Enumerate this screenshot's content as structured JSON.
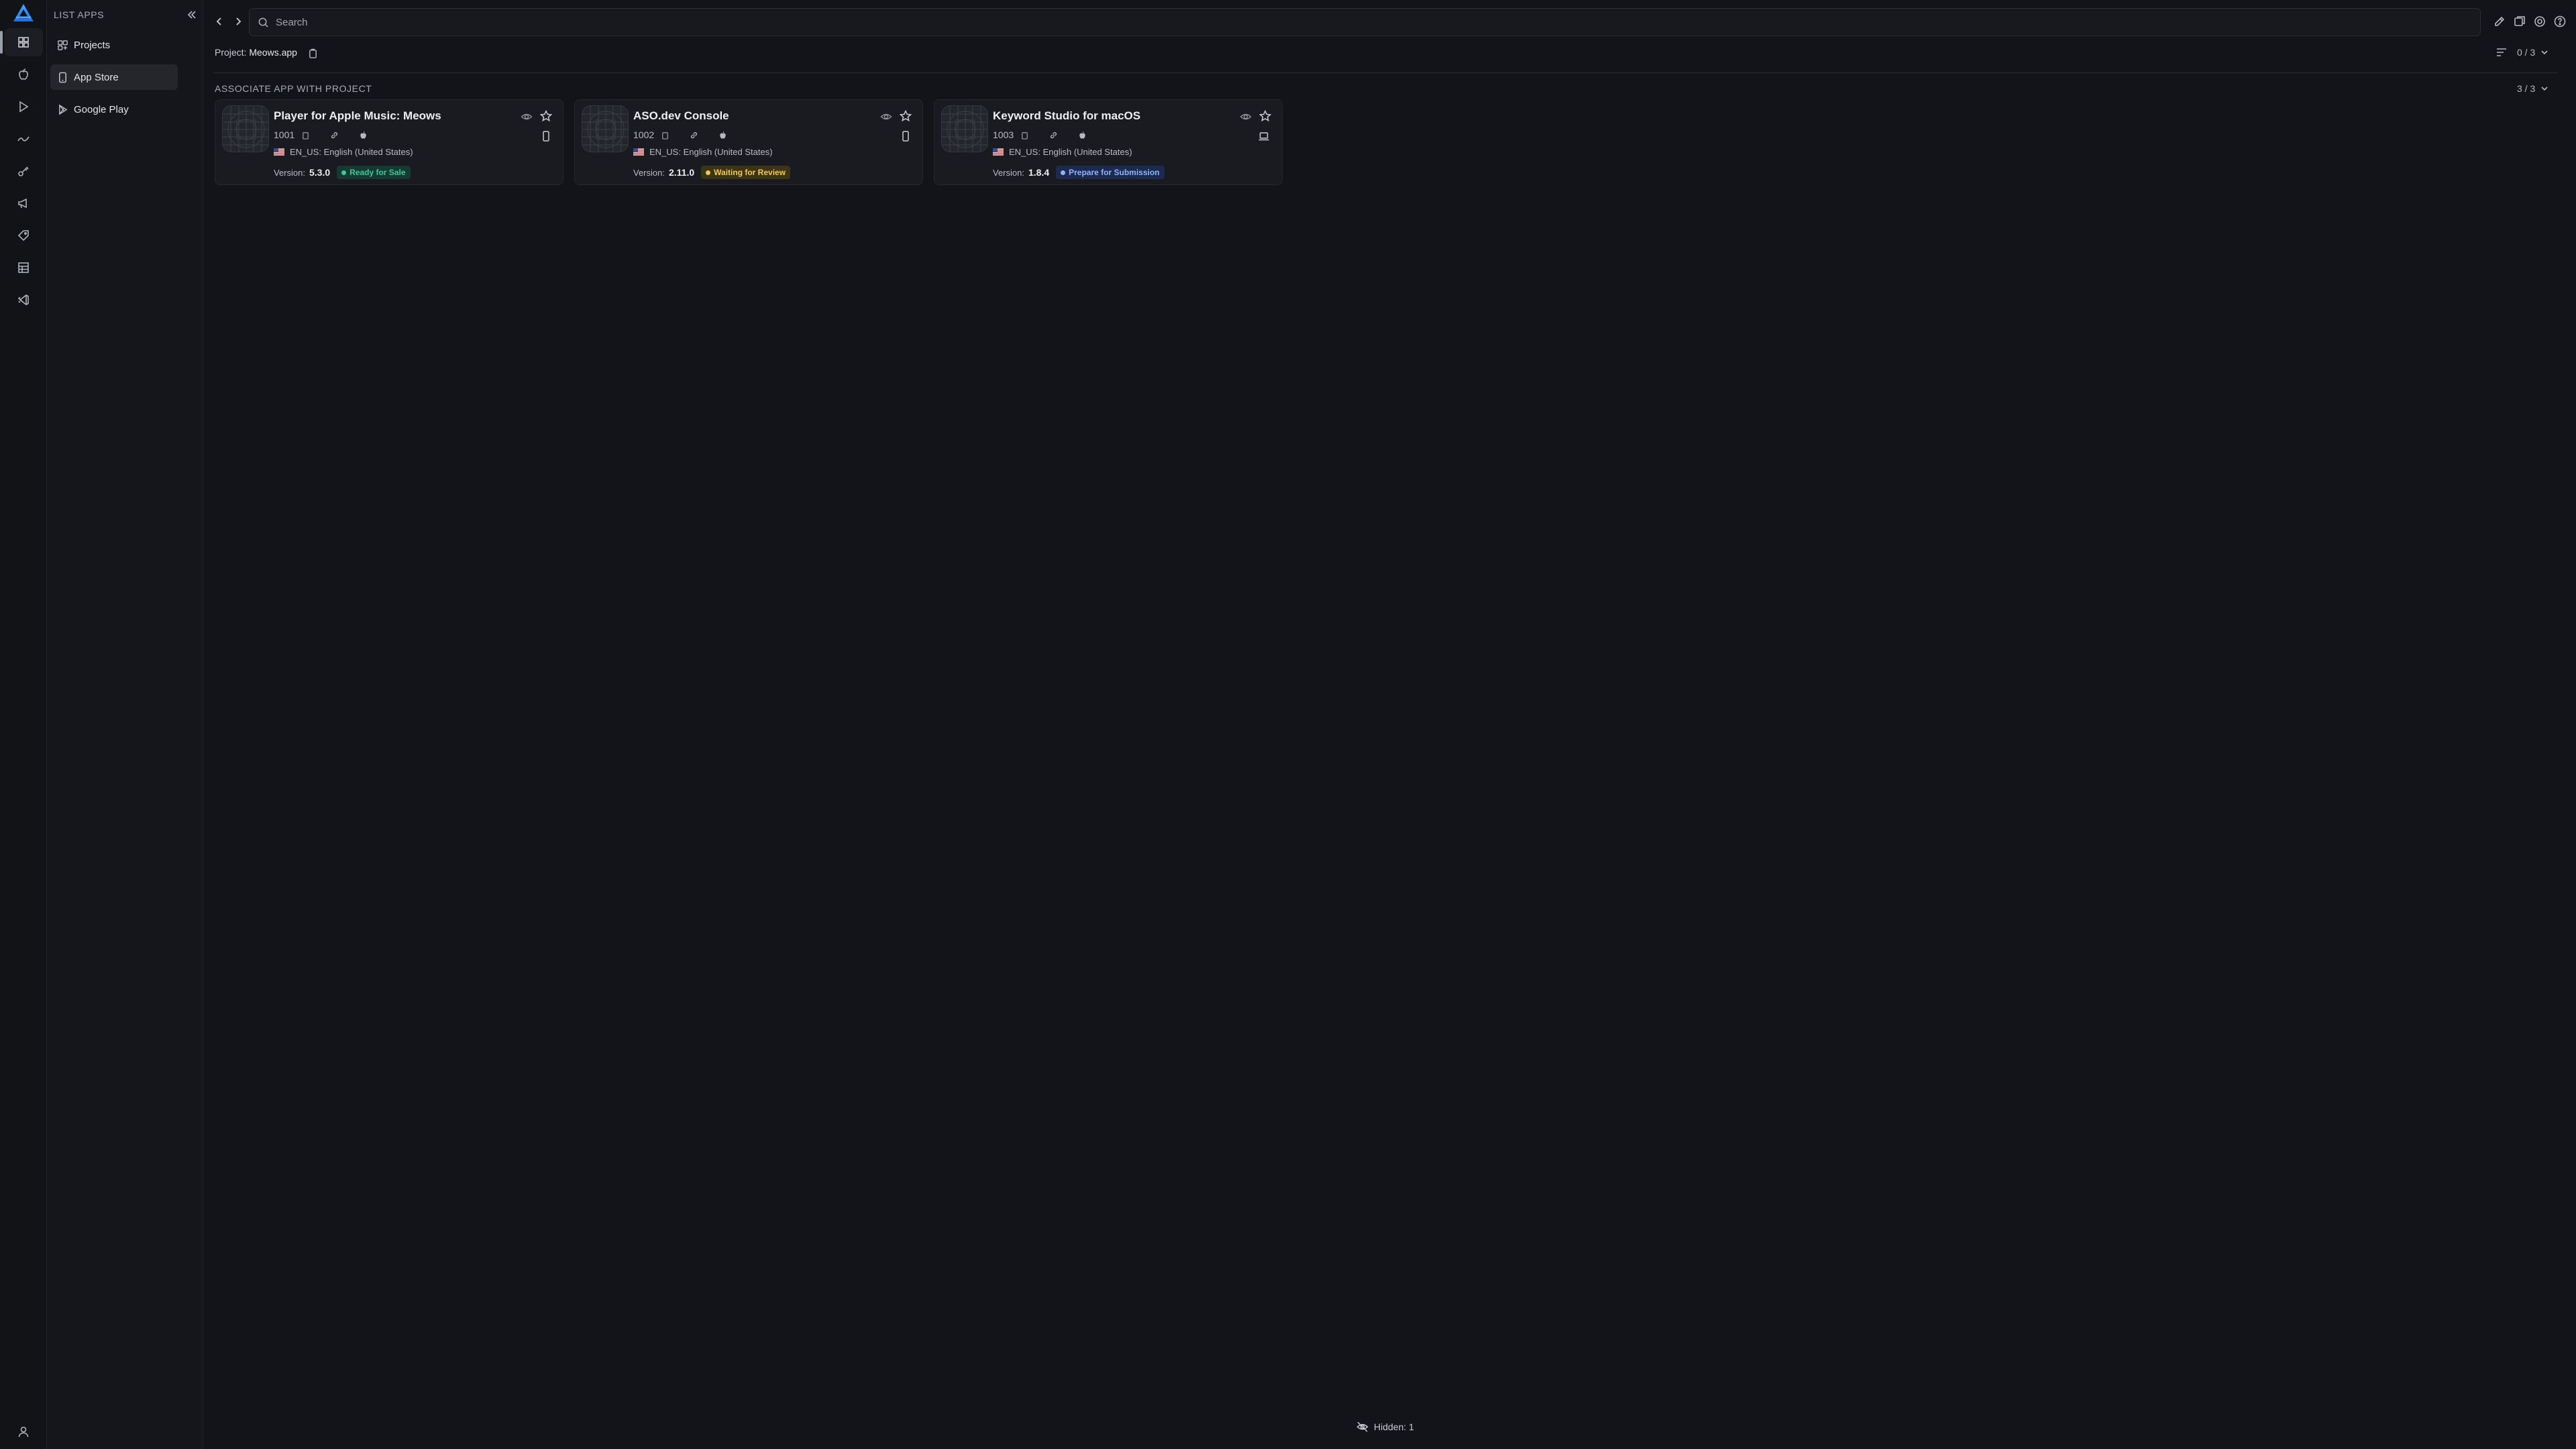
{
  "sidebar": {
    "title": "LIST APPS",
    "items": [
      {
        "label": "Projects",
        "icon": "projects-icon",
        "active": false
      },
      {
        "label": "App Store",
        "icon": "app-store-icon",
        "active": true
      },
      {
        "label": "Google Play",
        "icon": "google-play-icon",
        "active": false
      }
    ]
  },
  "rail": {
    "icons": [
      "grid-icon",
      "apple-icon",
      "play-icon",
      "trend-icon",
      "key-icon",
      "megaphone-icon",
      "tag-icon",
      "table-icon",
      "vscode-icon"
    ],
    "active_index": 0
  },
  "search": {
    "placeholder": "Search"
  },
  "project": {
    "label": "Project:",
    "name": "Meows.app"
  },
  "filter_count": "0 / 3",
  "section": {
    "title": "ASSOCIATE APP WITH PROJECT",
    "count": "3 / 3"
  },
  "apps": [
    {
      "name": "Player for Apple Music: Meows",
      "id": "1001",
      "locale": "EN_US: English (United States)",
      "version_label": "Version:",
      "version": "5.3.0",
      "status": "Ready for Sale",
      "status_color": "#3fc79a",
      "status_bg": "#153a31",
      "device": "phone-icon"
    },
    {
      "name": "ASO.dev Console",
      "id": "1002",
      "locale": "EN_US: English (United States)",
      "version_label": "Version:",
      "version": "2.11.0",
      "status": "Waiting for Review",
      "status_color": "#f2c94c",
      "status_bg": "#3c3417",
      "device": "phone-icon"
    },
    {
      "name": "Keyword Studio for macOS",
      "id": "1003",
      "locale": "EN_US: English (United States)",
      "version_label": "Version:",
      "version": "1.8.4",
      "status": "Prepare for Submission",
      "status_color": "#8fb3ff",
      "status_bg": "#1c2a4d",
      "device": "laptop-icon"
    }
  ],
  "footer": {
    "hidden": "Hidden: 1"
  },
  "colors": {
    "brand": "#2f80ed",
    "background": "#131419",
    "card": "#1a1b21"
  }
}
